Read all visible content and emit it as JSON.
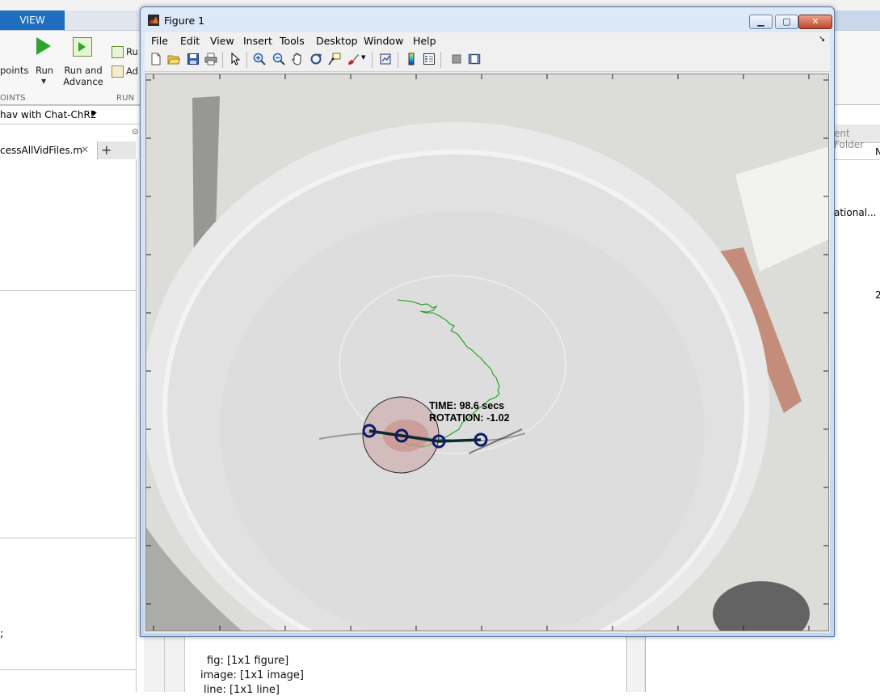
{
  "ribbon": {
    "active_tab": "VIEW",
    "breakpoints_label": "points",
    "run_label": "Run",
    "run_advance_label": "Run and Advance",
    "small_run_label": "Ru",
    "small_advance_label": "Ad",
    "section_breakpoints": "OINTS",
    "section_run": "RUN"
  },
  "address_bar": {
    "path": "hav with Chat-ChR2"
  },
  "editor": {
    "tab_label": "cessAllVidFiles.m",
    "code_fragment": ";"
  },
  "right_panel": {
    "header": "ent Folder",
    "col_header": "N",
    "item_text": "ational...",
    "item_value": "2"
  },
  "workspace_lines": [
    "fig: [1x1 figure]",
    "image: [1x1 image]",
    "line: [1x1 line]"
  ],
  "figure": {
    "title": "Figure 1",
    "controls": {
      "minimize": "▁",
      "maximize": "▢",
      "close": "✕"
    },
    "menus": [
      "File",
      "Edit",
      "View",
      "Insert",
      "Tools",
      "Desktop",
      "Window",
      "Help"
    ],
    "menu_overflow": "↘",
    "toolbar_icons": [
      "new-figure-icon",
      "open-file-icon",
      "save-icon",
      "print-icon",
      "edit-plot-arrow-icon",
      "zoom-in-icon",
      "zoom-out-icon",
      "pan-hand-icon",
      "rotate-3d-icon",
      "data-cursor-icon",
      "brush-icon",
      "link-plot-icon",
      "colorbar-icon",
      "legend-icon",
      "hide-plot-tools-icon",
      "show-plot-tools-icon"
    ],
    "overlay": {
      "time_text": "TIME: 98.6 secs",
      "rotation_text": "ROTATION: -1.02"
    },
    "colors": {
      "trajectory": "#1a9e1a",
      "skeleton": "#0b2a2a",
      "keypoint": "#0a1a6e",
      "body_circle": "#c8a0a0"
    }
  }
}
